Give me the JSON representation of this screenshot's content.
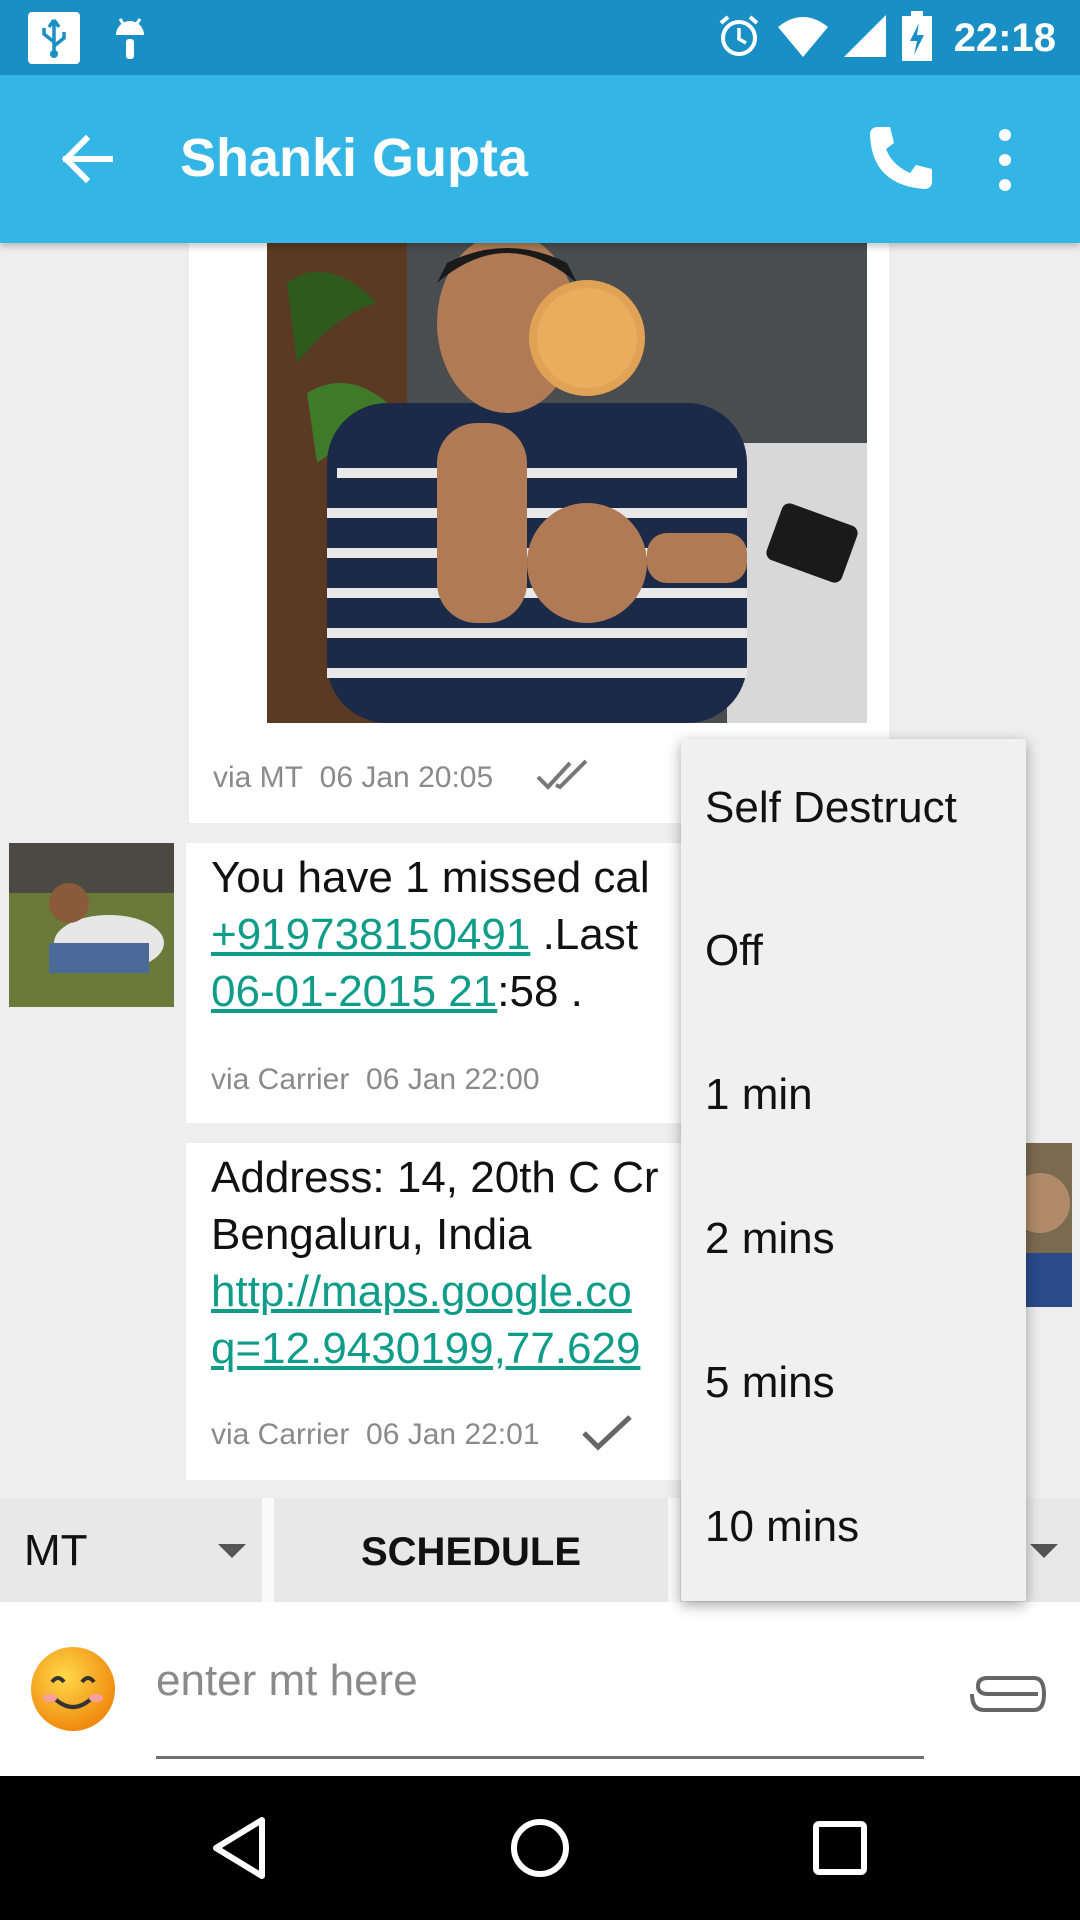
{
  "status_bar": {
    "time": "22:18",
    "icons": [
      "usb-icon",
      "android-debug-icon",
      "alarm-icon",
      "wifi-icon",
      "signal-icon",
      "battery-charging-icon"
    ]
  },
  "app_bar": {
    "title": "Shanki Gupta",
    "back_icon": "arrow-back-icon",
    "call_icon": "phone-icon",
    "more_icon": "more-vertical-icon",
    "background": "#33b5e5"
  },
  "messages": [
    {
      "type": "image",
      "via": "via MT",
      "time": "06 Jan 20:05",
      "status_icon": "double-check-icon"
    },
    {
      "type": "text",
      "lines": [
        {
          "text": "You have 1 missed cal"
        },
        {
          "link": "+919738150491",
          "text": " .Last"
        },
        {
          "link": "06-01-2015 21",
          "text": ":58 ."
        }
      ],
      "via": "via Carrier",
      "time": "06 Jan 22:00"
    },
    {
      "type": "text",
      "lines": [
        {
          "text": "Address: 14, 20th C Cr"
        },
        {
          "text": "Bengaluru, India"
        },
        {
          "link": "http://maps.google.co"
        },
        {
          "link": "q=12.9430199,77.629"
        }
      ],
      "via": "via Carrier",
      "time": "06 Jan 22:01",
      "status_icon": "check-icon"
    }
  ],
  "toolbar": {
    "channel_value": "MT",
    "schedule_label": "SCHEDULE"
  },
  "composer": {
    "placeholder": "enter mt here",
    "emoji_icon": "smiley-emoji-icon",
    "attach_icon": "paperclip-icon"
  },
  "self_destruct_menu": {
    "items": [
      "Self Destruct",
      "Off",
      "1 min",
      "2 mins",
      "5 mins",
      "10 mins"
    ]
  },
  "nav_bar": {
    "icons": [
      "nav-back-icon",
      "nav-home-icon",
      "nav-recents-icon"
    ]
  },
  "colors": {
    "status_bar": "#1a8fc6",
    "link": "#0f9d8a",
    "menu_bg": "#f0f0f0"
  }
}
